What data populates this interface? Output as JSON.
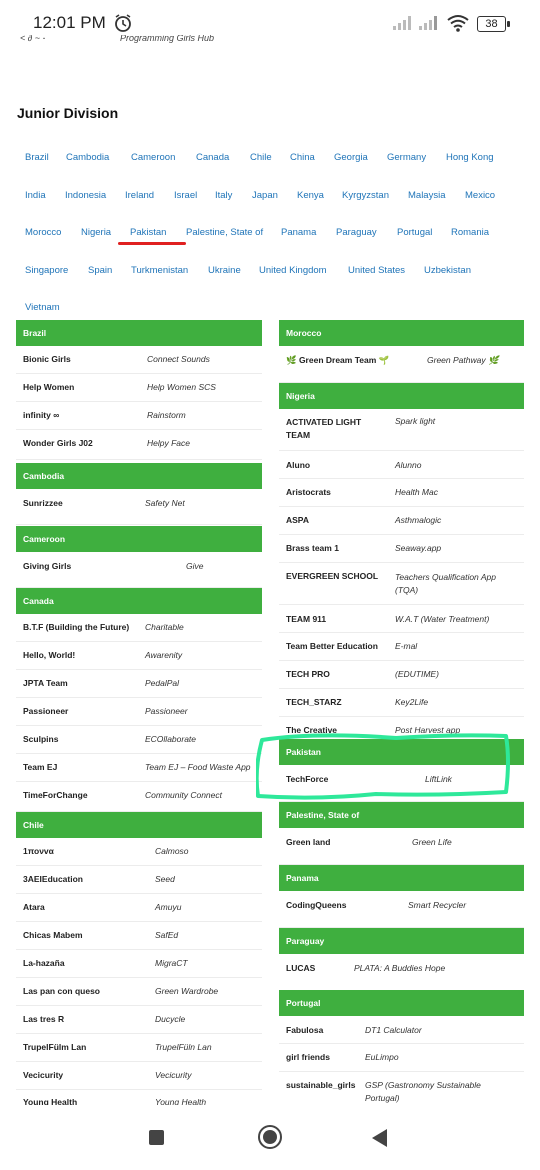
{
  "status": {
    "time": "12:01 PM",
    "battery": "38"
  },
  "clipped_top": {
    "left": "< ∂ ~ -",
    "center": "Programming Girls Hub"
  },
  "heading": "Junior Division",
  "countries": [
    [
      "Brazil",
      "Cambodia",
      "Cameroon",
      "Canada",
      "Chile",
      "China",
      "Georgia",
      "Germany",
      "Hong Kong"
    ],
    [
      "India",
      "Indonesia",
      "Ireland",
      "Israel",
      "Italy",
      "Japan",
      "Kenya",
      "Kyrgyzstan",
      "Malaysia",
      "Mexico"
    ],
    [
      "Morocco",
      "Nigeria",
      "Pakistan",
      "Palestine, State of",
      "Panama",
      "Paraguay",
      "Portugal",
      "Romania"
    ],
    [
      "Singapore",
      "Spain",
      "Turkmenistan",
      "Ukraine",
      "United Kingdom",
      "United States",
      "Uzbekistan"
    ],
    [
      "Vietnam"
    ]
  ],
  "left_sections": [
    {
      "country": "Brazil",
      "teams": [
        {
          "team": "Bionic Girls",
          "app": "Connect Sounds"
        },
        {
          "team": "Help Women",
          "app": "Help Women SCS"
        },
        {
          "team": "infinity ∞",
          "app": "Rainstorm"
        },
        {
          "team": "Wonder Girls J02",
          "app": "Helpy Face"
        }
      ]
    },
    {
      "country": "Cambodia",
      "teams": [
        {
          "team": "Sunrizzee",
          "app": "Safety Net"
        }
      ]
    },
    {
      "country": "Cameroon",
      "teams": [
        {
          "team": "Giving Girls",
          "app": "Give"
        }
      ]
    },
    {
      "country": "Canada",
      "teams": [
        {
          "team": "B.T.F (Building the Future)",
          "app": "Charitable"
        },
        {
          "team": "Hello, World!",
          "app": "Awarenity"
        },
        {
          "team": "JPTA Team",
          "app": "PedalPal"
        },
        {
          "team": "Passioneer",
          "app": "Passioneer"
        },
        {
          "team": "Sculpins",
          "app": "ECOllaborate"
        },
        {
          "team": "Team EJ",
          "app": "Team EJ – Food Waste App"
        },
        {
          "team": "TimeForChange",
          "app": "Community Connect"
        }
      ]
    },
    {
      "country": "Chile",
      "teams": [
        {
          "team": "1πονvα",
          "app": "Calmoso"
        },
        {
          "team": "3AEIEducation",
          "app": "Seed"
        },
        {
          "team": "Atara",
          "app": "Amuyu"
        },
        {
          "team": "Chicas Mabem",
          "app": "SafEd"
        },
        {
          "team": "La-hazaña",
          "app": "MigraCT"
        },
        {
          "team": "Las pan con queso",
          "app": "Green Wardrobe"
        },
        {
          "team": "Las tres R",
          "app": "Ducycle"
        },
        {
          "team": "TrupelFülm Lan",
          "app": "TrupelFüln Lan"
        },
        {
          "team": "Vecicurity",
          "app": "Vecicurity"
        },
        {
          "team": "Young Health",
          "app": "Young Health"
        }
      ]
    }
  ],
  "right_sections": [
    {
      "country": "Morocco",
      "teams": [
        {
          "team": "🌿 Green Dream Team 🌱",
          "app": "Green Pathway 🌿"
        }
      ]
    },
    {
      "country": "Nigeria",
      "teams": [
        {
          "team": "ACTIVATED LIGHT TEAM",
          "app": "Spark light"
        },
        {
          "team": "Aluno",
          "app": "Alunno"
        },
        {
          "team": "Aristocrats",
          "app": "Health Mac"
        },
        {
          "team": "ASPA",
          "app": "Asthmalogic"
        },
        {
          "team": "Brass team 1",
          "app": "Seaway.app"
        },
        {
          "team": "EVERGREEN SCHOOL",
          "app": "Teachers Qualification App (TQA)"
        },
        {
          "team": "TEAM 911",
          "app": "W.A.T (Water Treatment)"
        },
        {
          "team": "Team Better Education",
          "app": "E-mal"
        },
        {
          "team": "TECH PRO",
          "app": "(EDUTIME)"
        },
        {
          "team": "TECH_STARZ",
          "app": "Key2Life"
        },
        {
          "team": "The Creative",
          "app": "Post Harvest app"
        }
      ]
    },
    {
      "country": "Pakistan",
      "teams": [
        {
          "team": "TechForce",
          "app": "LiftLink"
        }
      ]
    },
    {
      "country": "Palestine, State of",
      "teams": [
        {
          "team": "Green land",
          "app": "Green Life"
        }
      ]
    },
    {
      "country": "Panama",
      "teams": [
        {
          "team": "CodingQueens",
          "app": "Smart Recycler"
        }
      ]
    },
    {
      "country": "Paraguay",
      "teams": [
        {
          "team": "LUCAS",
          "app": "PLATA: A Buddies Hope"
        }
      ]
    },
    {
      "country": "Portugal",
      "teams": [
        {
          "team": "Fabulosa",
          "app": "DT1 Calculator"
        },
        {
          "team": "girl friends",
          "app": "EuLimpo"
        },
        {
          "team": "sustainable_girls",
          "app": "GSP (Gastronomy Sustainable Portugal)"
        }
      ]
    }
  ],
  "colors": {
    "accent": "#3faf3f",
    "link": "#1f74b8",
    "underline": "#e02020",
    "highlight": "#2ee89a"
  }
}
